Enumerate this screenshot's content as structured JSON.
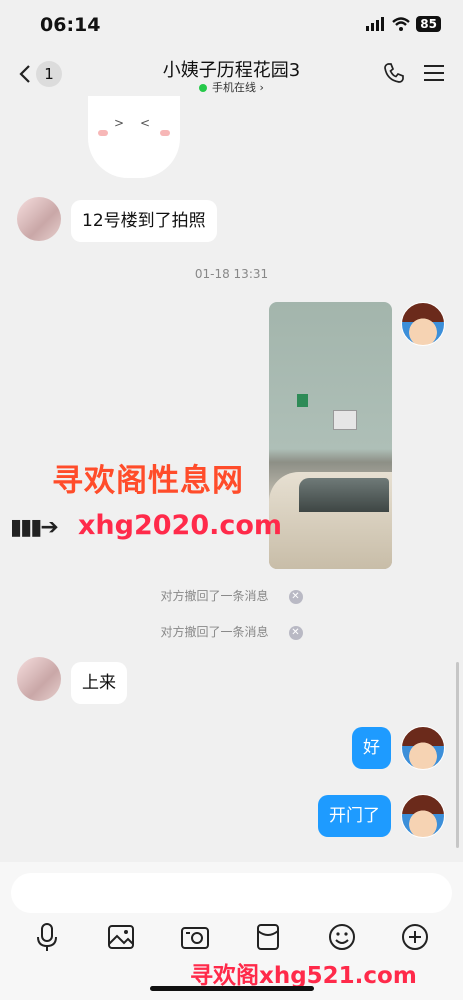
{
  "status": {
    "time": "06:14",
    "battery": "85"
  },
  "header": {
    "back_count": "1",
    "title": "小姨子历程花园3",
    "online_status": "手机在线",
    "call_icon": "phone-icon",
    "menu_icon": "menu-icon"
  },
  "messages": {
    "msg1": "12号楼到了拍照",
    "timestamp": "01-18 13:31",
    "recall1": "对方撤回了一条消息",
    "recall2": "对方撤回了一条消息",
    "msg2": "上来",
    "msg3": "好",
    "msg4": "开门了"
  },
  "watermarks": {
    "top": "寻欢阁性息网",
    "middle": "xhg2020.com",
    "bottom": "寻欢阁xhg521.com"
  },
  "input": {
    "placeholder": ""
  },
  "toolbar": [
    "microphone-icon",
    "image-icon",
    "camera-icon",
    "red-packet-icon",
    "emoji-icon",
    "plus-icon"
  ],
  "colors": {
    "bubble_out": "#1e9bff",
    "bubble_in": "#ffffff",
    "background": "#f0f0f0",
    "online": "#26c94a"
  }
}
